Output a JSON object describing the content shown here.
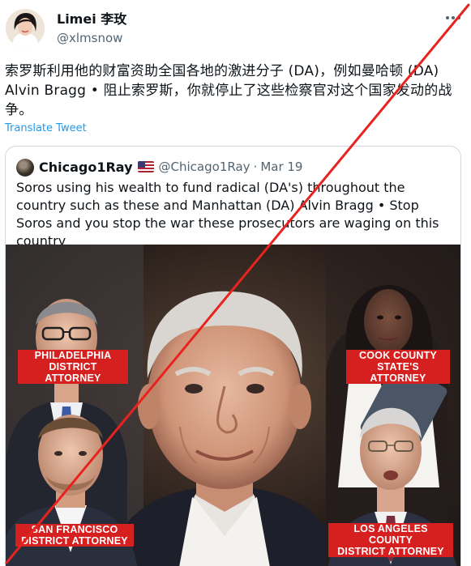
{
  "tweet": {
    "author": {
      "display_name": "Limei 李玫",
      "handle": "@xlmsnow"
    },
    "text": "索罗斯利用他的财富资助全国各地的激进分子 (DA)，例如曼哈顿 (DA) Alvin Bragg • 阻止索罗斯，你就停止了这些检察官对这个国家发动的战争。",
    "translate_label": "Translate Tweet",
    "more_icon": "more-dots-icon"
  },
  "quote": {
    "author": {
      "display_name": "Chicago1Ray",
      "flag": "us-flag-icon",
      "handle": "@Chicago1Ray",
      "separator": "·",
      "date": "Mar 19"
    },
    "text": "Soros using his wealth to fund radical (DA's) throughout the country such as these and Manhattan (DA) Alvin Bragg • Stop Soros and you stop the war these prosecutors are waging on this country",
    "image": {
      "labels": {
        "philadelphia": [
          "PHILADELPHIA",
          "DISTRICT ATTORNEY"
        ],
        "cook_county": [
          "COOK COUNTY",
          "STATE'S ATTORNEY"
        ],
        "san_francisco": [
          "SAN FRANCISCO",
          "DISTRICT ATTORNEY"
        ],
        "los_angeles": [
          "LOS ANGELES COUNTY",
          "DISTRICT ATTORNEY"
        ]
      }
    }
  },
  "overlay": {
    "slash_color": "#e8231f"
  },
  "colors": {
    "text_primary": "#0f1419",
    "text_secondary": "#536471",
    "link": "#1d9bf0",
    "border": "#cfd9de",
    "label_red": "#d61f1f"
  }
}
